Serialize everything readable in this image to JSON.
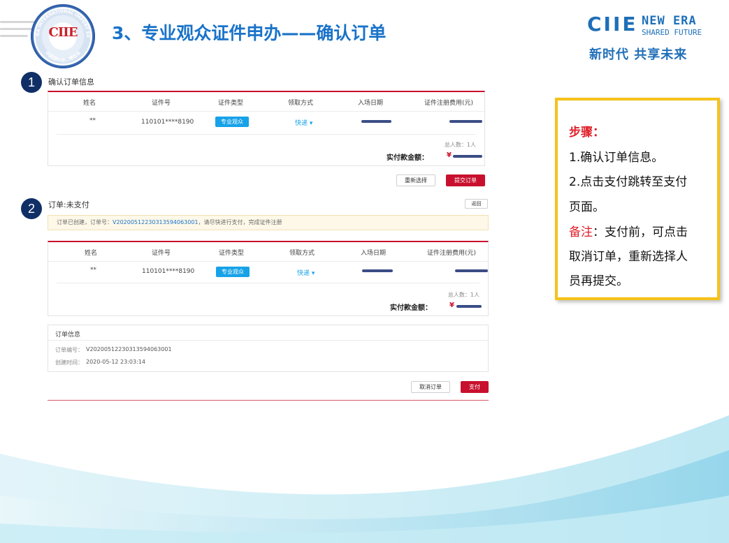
{
  "header": {
    "title": "3、专业观众证件申办——确认订单",
    "logo_text": "CIIE",
    "logo_ring_text": "CHINA INTERNATIONAL IMPORT EXPO",
    "logo_ring_cn": "中国国际进口博览会",
    "brand": {
      "ciie": "CIIE",
      "en_line1": "NEW ERA",
      "en_line2": "SHARED FUTURE",
      "cn": "新时代 共享未来"
    }
  },
  "step1": {
    "badge": "1",
    "label": "确认订单信息",
    "table": {
      "headers": [
        "姓名",
        "证件号",
        "证件类型",
        "领取方式",
        "入场日期",
        "证件注册费用(元)"
      ],
      "row": {
        "name": "**",
        "id_number": "110101****8190",
        "cert_type": "专业观众",
        "pickup": "快递 ▾"
      },
      "total_people": "总人数：1人",
      "amount_label": "实付款金额：",
      "amount_currency": "¥"
    },
    "buttons": {
      "reselect": "重新选择",
      "submit": "提交订单"
    }
  },
  "step2": {
    "badge": "2",
    "label": "订单:未支付",
    "back_button": "返回",
    "notice_prefix": "订单已创建，订单号：",
    "notice_order_no": "V20200512230313594063001",
    "notice_suffix": "，请尽快进行支付，完成证件注册",
    "table": {
      "headers": [
        "姓名",
        "证件号",
        "证件类型",
        "领取方式",
        "入场日期",
        "证件注册费用(元)"
      ],
      "row": {
        "name": "**",
        "id_number": "110101****8190",
        "cert_type": "专业观众",
        "pickup": "快递 ▾"
      },
      "total_people": "总人数：1人",
      "amount_label": "实付款金额：",
      "amount_currency": "¥"
    },
    "order_info": {
      "title": "订单信息",
      "order_no_label": "订单编号：",
      "order_no": "V20200512230313594063001",
      "created_label": "创建时间：",
      "created_time": "2020-05-12 23:03:14"
    },
    "buttons": {
      "cancel": "取消订单",
      "pay": "支付"
    }
  },
  "note": {
    "heading": "步骤：",
    "lines": [
      "1.确认订单信息。",
      "2.点击支付跳转至支付",
      "页面。"
    ],
    "remark_label": "备注",
    "remark_lines": [
      "：支付前，可点击",
      "取消订单，重新选择人",
      "员再提交。"
    ]
  },
  "colors": {
    "brand_blue": "#1f6fb8",
    "title_blue": "#1a73c9",
    "accent_red": "#c8102e",
    "pill_blue": "#17a2e8",
    "note_border": "#f5c21a",
    "badge_navy": "#0f2f66"
  }
}
